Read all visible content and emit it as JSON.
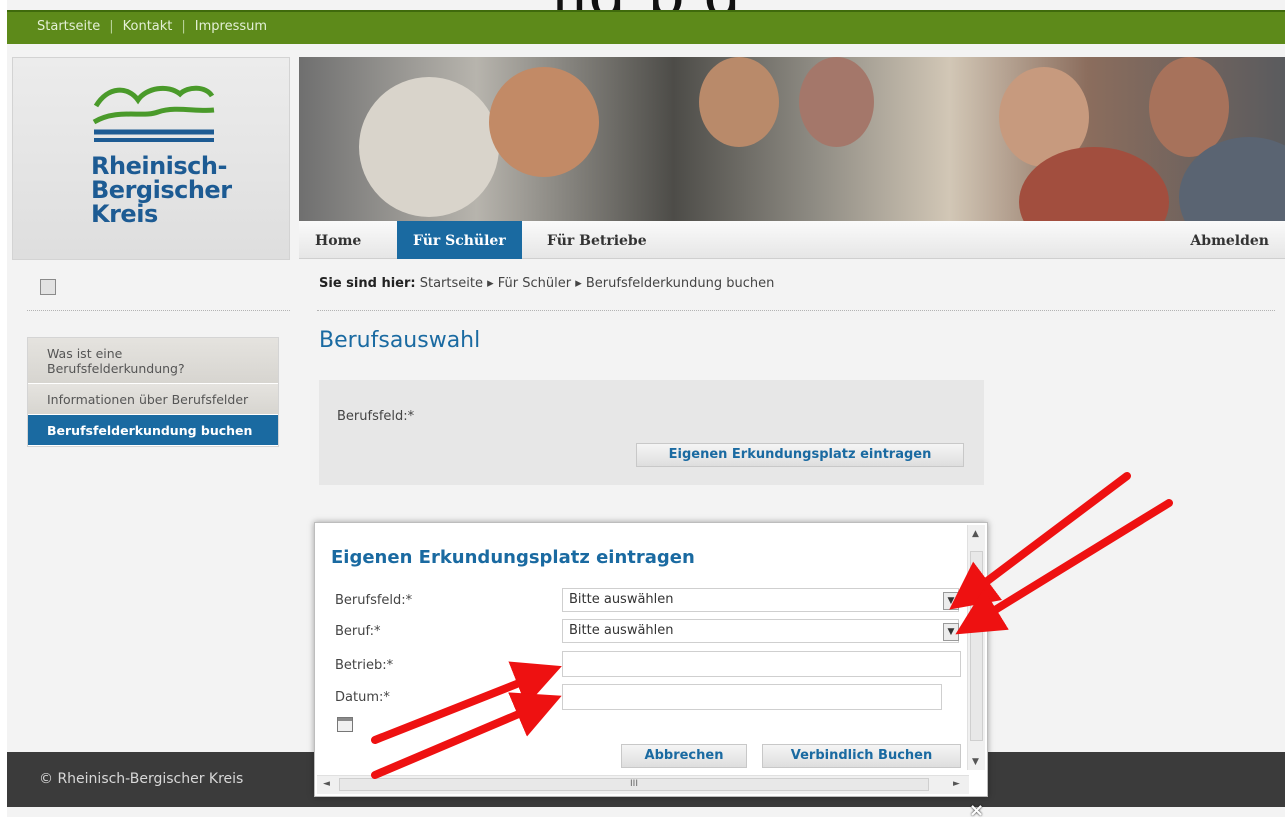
{
  "topbar": {
    "links": [
      "Startseite",
      "Kontakt",
      "Impressum"
    ]
  },
  "logo": {
    "line1": "Rheinisch-",
    "line2": "Bergischer",
    "line3": "Kreis"
  },
  "nav": {
    "home": "Home",
    "schueler": "Für Schüler",
    "betriebe": "Für Betriebe",
    "logout": "Abmelden"
  },
  "breadcrumb": {
    "prefix": "Sie sind hier:",
    "path": "Startseite ▸ Für Schüler ▸ Berufsfelderkundung buchen"
  },
  "sidebar": {
    "items": [
      {
        "label": "Was ist eine Berufsfelderkundung?"
      },
      {
        "label": "Informationen über Berufsfelder"
      },
      {
        "label": "Berufsfelderkundung buchen"
      }
    ]
  },
  "main": {
    "title": "Berufsauswahl",
    "field_label": "Berufsfeld:*",
    "button": "Eigenen Erkundungsplatz eintragen"
  },
  "footer": {
    "copyright": "© Rheinisch-Bergischer Kreis"
  },
  "modal": {
    "title": "Eigenen Erkundungsplatz eintragen",
    "berufsfeld_label": "Berufsfeld:*",
    "berufsfeld_value": "Bitte auswählen",
    "beruf_label": "Beruf:*",
    "beruf_value": "Bitte auswählen",
    "betrieb_label": "Betrieb:*",
    "datum_label": "Datum:*",
    "cancel": "Abbrechen",
    "submit": "Verbindlich Buchen"
  },
  "colors": {
    "green": "#5d8a1a",
    "blue": "#1a6aa1",
    "annotation": "#ee1111"
  }
}
